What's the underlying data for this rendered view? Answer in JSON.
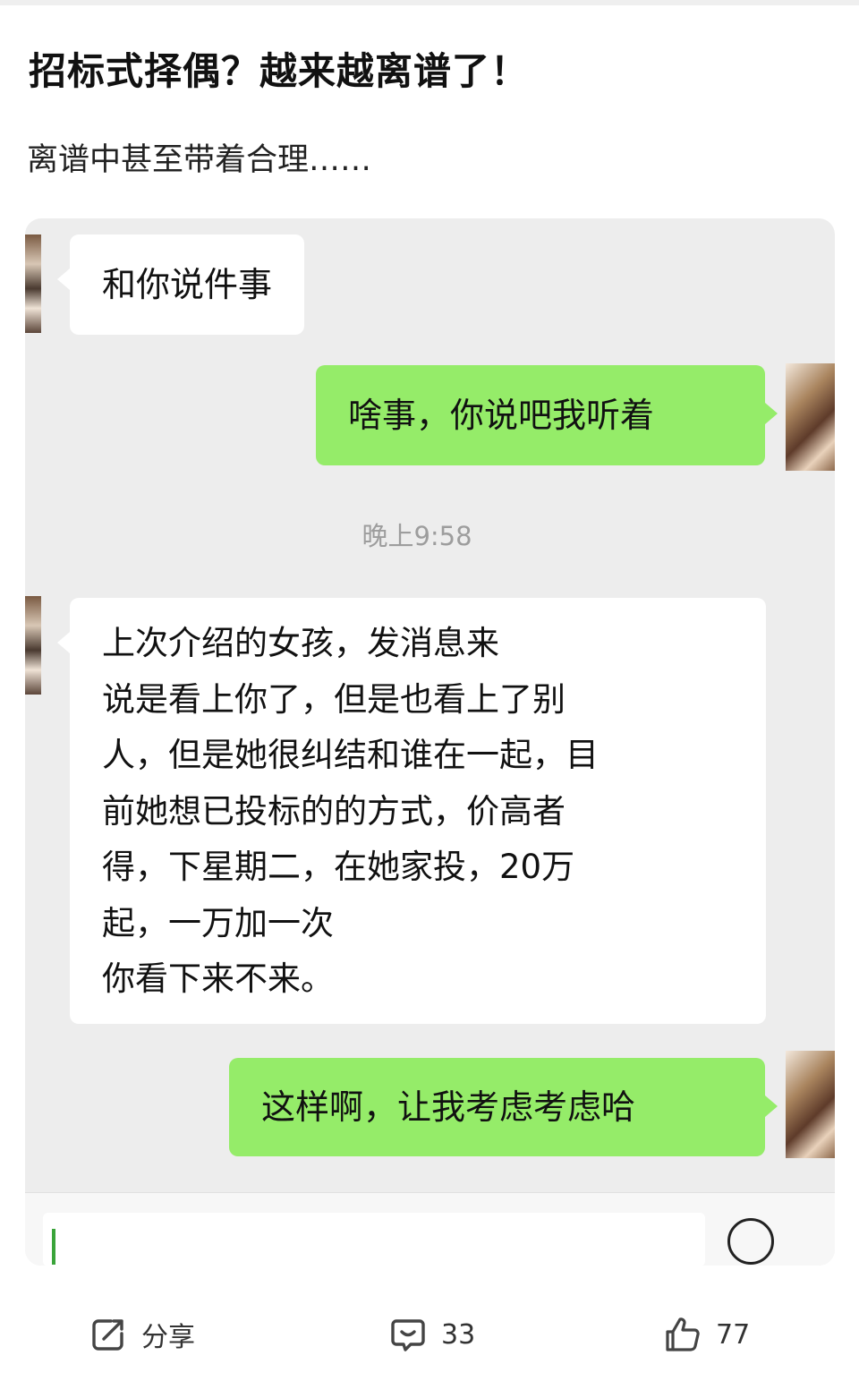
{
  "post": {
    "title": "招标式择偶？越来越离谱了！",
    "subtitle": "离谱中甚至带着合理……"
  },
  "chat": {
    "messages": [
      {
        "side": "left",
        "text": "和你说件事"
      },
      {
        "side": "right",
        "text": "啥事，你说吧我听着"
      },
      {
        "side": "left",
        "text": "上次介绍的女孩，发消息来\n说是看上你了，但是也看上了别\n人，但是她很纠结和谁在一起，目\n前她想已投标的的方式，价高者\n得，下星期二，在她家投，20万\n起，一万加一次\n你看下来不来。"
      },
      {
        "side": "right",
        "text": "这样啊，让我考虑考虑哈"
      }
    ],
    "timestamp": "晚上9:58"
  },
  "actions": {
    "share_label": "分享",
    "comment_count": "33",
    "like_count": "77"
  },
  "icons": {
    "share": "share-icon",
    "comment": "comment-icon",
    "like": "thumbs-up-icon",
    "emoji": "emoji-icon"
  },
  "colors": {
    "sent_bubble": "#95ec69",
    "received_bubble": "#ffffff",
    "chat_background": "#ededed"
  }
}
